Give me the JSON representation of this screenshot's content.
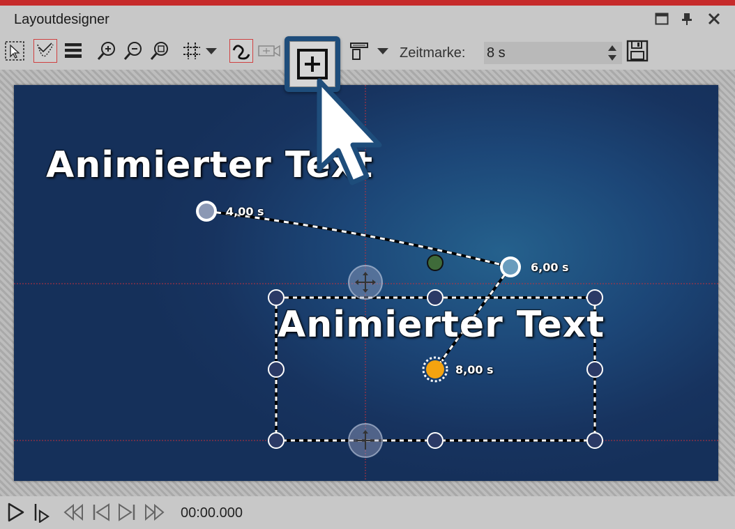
{
  "window": {
    "title": "Layoutdesigner",
    "icons": [
      "maximize-icon",
      "pin-icon",
      "close-icon"
    ]
  },
  "toolbar": {
    "timestamp_label": "Zeitmarke:",
    "timestamp_value": "8 s",
    "icons": [
      "selection-tool-icon",
      "motion-path-icon",
      "layers-icon",
      "zoom-in-icon",
      "zoom-out-icon",
      "zoom-fit-icon",
      "grid-icon",
      "curve-path-icon",
      "camera-icon",
      "add-keyframe-icon",
      "align-icon",
      "save-icon"
    ]
  },
  "canvas": {
    "text_top": "Animierter Text",
    "text_selected": "Animierter Text",
    "keyframes": [
      {
        "label": "4,00 s"
      },
      {
        "label": "6,00 s"
      },
      {
        "label": "8,00 s"
      }
    ]
  },
  "playback": {
    "timecode": "00:00.000",
    "icons": [
      "play-icon",
      "play-from-cursor-icon",
      "rewind-icon",
      "skip-back-icon",
      "skip-forward-icon",
      "fast-forward-icon"
    ]
  },
  "colors": {
    "accent": "#c62b2b",
    "canvas_bg": "#1c4677",
    "keyframe_active": "#f5a30f",
    "highlight_border": "#1e4d7b"
  }
}
